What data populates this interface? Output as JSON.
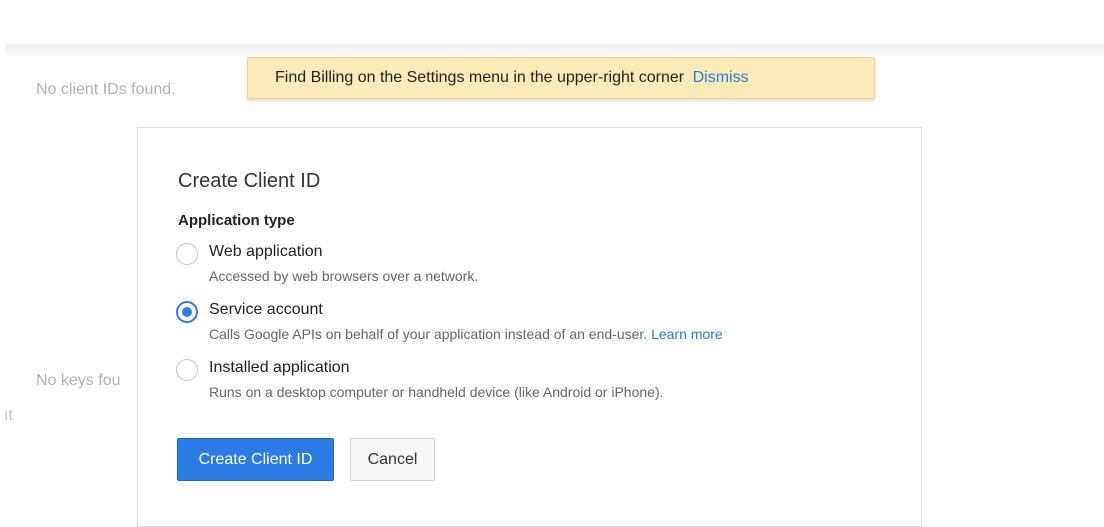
{
  "background": {
    "no_client_ids": "No client IDs found.",
    "no_keys": "No keys fou",
    "cut_text": "ıt"
  },
  "banner": {
    "message": "Find Billing on the Settings menu in the upper-right corner",
    "dismiss_label": "Dismiss",
    "bg_color": "#fcebb8"
  },
  "dialog": {
    "title": "Create Client ID",
    "section_label": "Application type",
    "selected_option": "Service account",
    "options": [
      {
        "label": "Web application",
        "description": "Accessed by web browsers over a network.",
        "checked": false
      },
      {
        "label": "Service account",
        "description": "Calls Google APIs on behalf of your application instead of an end-user.",
        "link": "Learn more",
        "checked": true
      },
      {
        "label": "Installed application",
        "description": "Runs on a desktop computer or handheld device (like Android or iPhone).",
        "checked": false
      }
    ],
    "primary_button": "Create Client ID",
    "secondary_button": "Cancel"
  },
  "colors": {
    "accent": "#2a7be4",
    "link": "#2f79d6",
    "radio_checked": "#2f7de1"
  }
}
